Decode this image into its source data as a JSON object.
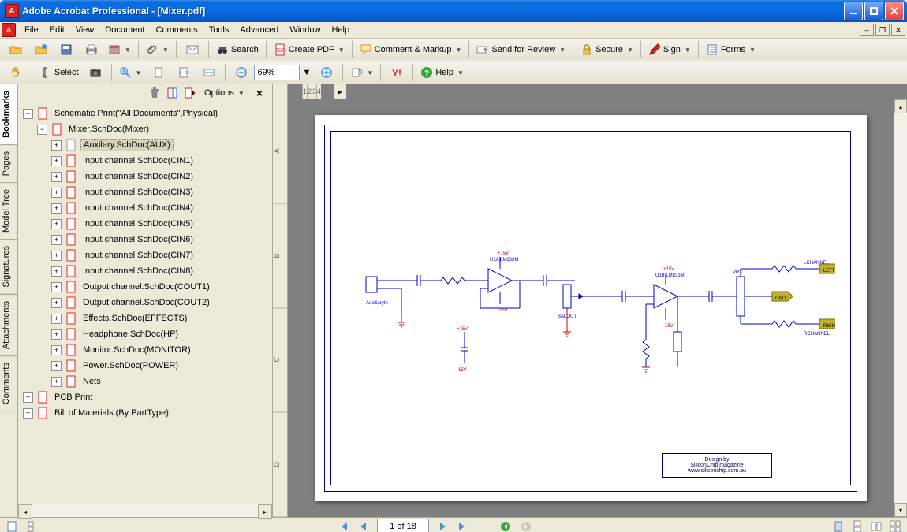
{
  "window": {
    "title": "Adobe Acrobat Professional - [Mixer.pdf]"
  },
  "menu": {
    "items": [
      "File",
      "Edit",
      "View",
      "Document",
      "Comments",
      "Tools",
      "Advanced",
      "Window",
      "Help"
    ]
  },
  "toolbar1": {
    "search": "Search",
    "createpdf": "Create PDF",
    "comment": "Comment & Markup",
    "review": "Send for Review",
    "secure": "Secure",
    "sign": "Sign",
    "forms": "Forms"
  },
  "toolbar2": {
    "select": "Select",
    "zoom": "69%",
    "help": "Help"
  },
  "bmtoolbar": {
    "options": "Options"
  },
  "sidetabs": [
    "Bookmarks",
    "Pages",
    "Model Tree",
    "Signatures",
    "Attachments",
    "Comments"
  ],
  "bookmarks": {
    "root": {
      "label": "Schematic Print(\"All Documents\",Physical)"
    },
    "mixer": {
      "label": "Mixer.SchDoc(Mixer)"
    },
    "aux": {
      "label": "Auxilary.SchDoc(AUX)"
    },
    "children": [
      "Input channel.SchDoc(CIN1)",
      "Input channel.SchDoc(CIN2)",
      "Input channel.SchDoc(CIN3)",
      "Input channel.SchDoc(CIN4)",
      "Input channel.SchDoc(CIN5)",
      "Input channel.SchDoc(CIN6)",
      "Input channel.SchDoc(CIN7)",
      "Input channel.SchDoc(CIN8)",
      "Output channel.SchDoc(COUT1)",
      "Output channel.SchDoc(COUT2)",
      "Effects.SchDoc(EFFECTS)",
      "Headphone.SchDoc(HP)",
      "Monitor.SchDoc(MONITOR)",
      "Power.SchDoc(POWER)",
      "Nets"
    ],
    "pcb": "PCB Print",
    "bom": "Bill of Materials (By PartType)"
  },
  "schematic": {
    "labels": {
      "rails_pos": "+15V",
      "rails_neg": "-15V",
      "auxin": "AuxiliaryIn",
      "opamp1": "U1A LM833M",
      "opamp2": "U1B LM833M",
      "balance": "BALOUT",
      "lchannel": "LCHANNEL",
      "rchannel": "RCHANNEL",
      "left": "LEFT",
      "right": "RIGHT",
      "gnd": "GND"
    },
    "titleblock": [
      "Design by",
      "SiliconChip magazine",
      "www.siliconchip.com.au"
    ]
  },
  "ruler": {
    "h": [
      "1",
      "2",
      "3",
      "4"
    ],
    "v": [
      "A",
      "B",
      "C",
      "D"
    ]
  },
  "nav": {
    "page": "1 of 18"
  }
}
